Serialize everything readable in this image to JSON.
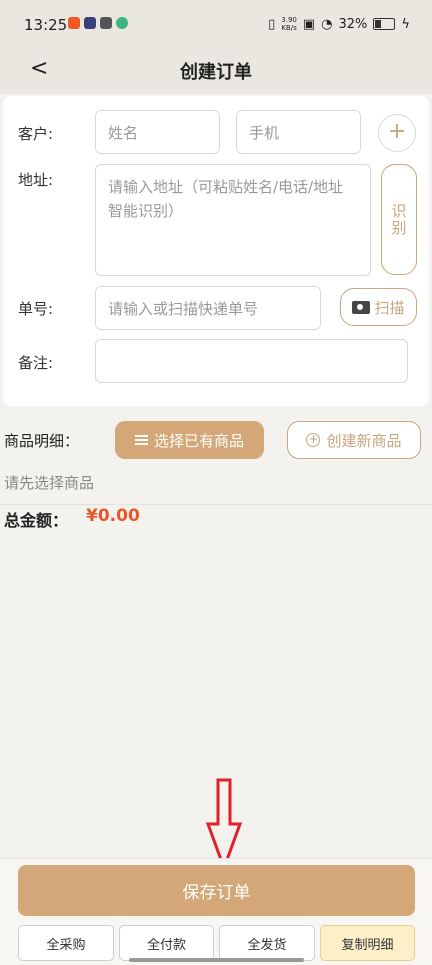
{
  "status_bar": {
    "time": "13:25",
    "net_speed_value": "3.90",
    "net_speed_unit": "KB/s",
    "battery": "32%"
  },
  "header": {
    "back_label": "<",
    "title": "创建订单"
  },
  "form": {
    "customer_label": "客户:",
    "name_placeholder": "姓名",
    "phone_placeholder": "手机",
    "add_label": "+",
    "address_label": "地址:",
    "address_placeholder": "请输入地址（可粘贴姓名/电话/地址智能识别）",
    "recognize_label": "识别",
    "tracking_label": "单号:",
    "tracking_placeholder": "请输入或扫描快递单号",
    "scan_label": "扫描",
    "note_label": "备注:",
    "note_value": ""
  },
  "goods": {
    "label": "商品明细：",
    "select_existing": "选择已有商品",
    "create_new": "创建新商品",
    "hint": "请先选择商品",
    "total_label": "总金额：",
    "total_value": "¥0.00"
  },
  "footer": {
    "save": "保存订单",
    "buttons": [
      "全采购",
      "全付款",
      "全发货",
      "复制明细"
    ]
  },
  "colors": {
    "accent": "#d3a777",
    "price": "#e8572a",
    "highlight": "#fdf0c9",
    "annotation_arrow": "#e0202a"
  }
}
